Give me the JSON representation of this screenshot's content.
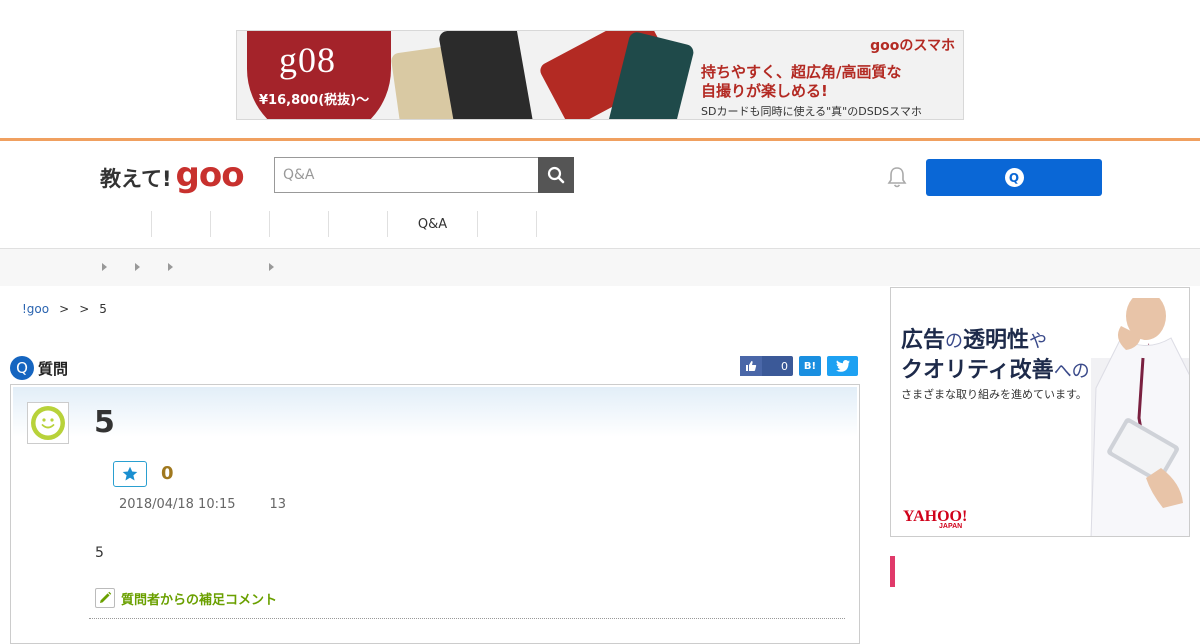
{
  "top_ad": {
    "model": "g08",
    "price": "¥16,800(税抜)〜",
    "brand": "gooのスマホ",
    "copy_line1": "持ちやすく、超広角/高画質な",
    "copy_line2": "自撮りが楽しめる!",
    "sub": "SDカードも同時に使える\"真\"のDSDSスマホ"
  },
  "header": {
    "logo_text": "教えて!",
    "logo_brand": "goo",
    "search_placeholder": "Q&A",
    "ask_icon": "Q"
  },
  "global_nav": [
    "",
    "",
    "",
    "",
    "",
    "Q&A",
    "",
    ""
  ],
  "breadcrumb": {
    "home": "!goo",
    "sep1": ">",
    "sep2": ">",
    "current": "5"
  },
  "question": {
    "section_label": "質問",
    "badge": "Q",
    "title": "5",
    "favorite_count": "0",
    "date": "2018/04/18 10:15",
    "views": "13",
    "body": "5",
    "supplement_label": "質問者からの補足コメント"
  },
  "share": {
    "fb_count": "0",
    "hatena": "B!"
  },
  "right_ad": {
    "line1_a": "広告",
    "line1_b": "の",
    "line1_c": "透明性",
    "line1_d": "や",
    "line2_a": "クオリティ改善",
    "line2_b": "への",
    "line3": "さまざまな取り組みを進めています。",
    "logo": "YAHOO!",
    "logo_sub": "JAPAN"
  },
  "colors": {
    "accent_blue": "#0a67d6",
    "brand_red": "#c8312e",
    "orange_line": "#f0a060"
  }
}
